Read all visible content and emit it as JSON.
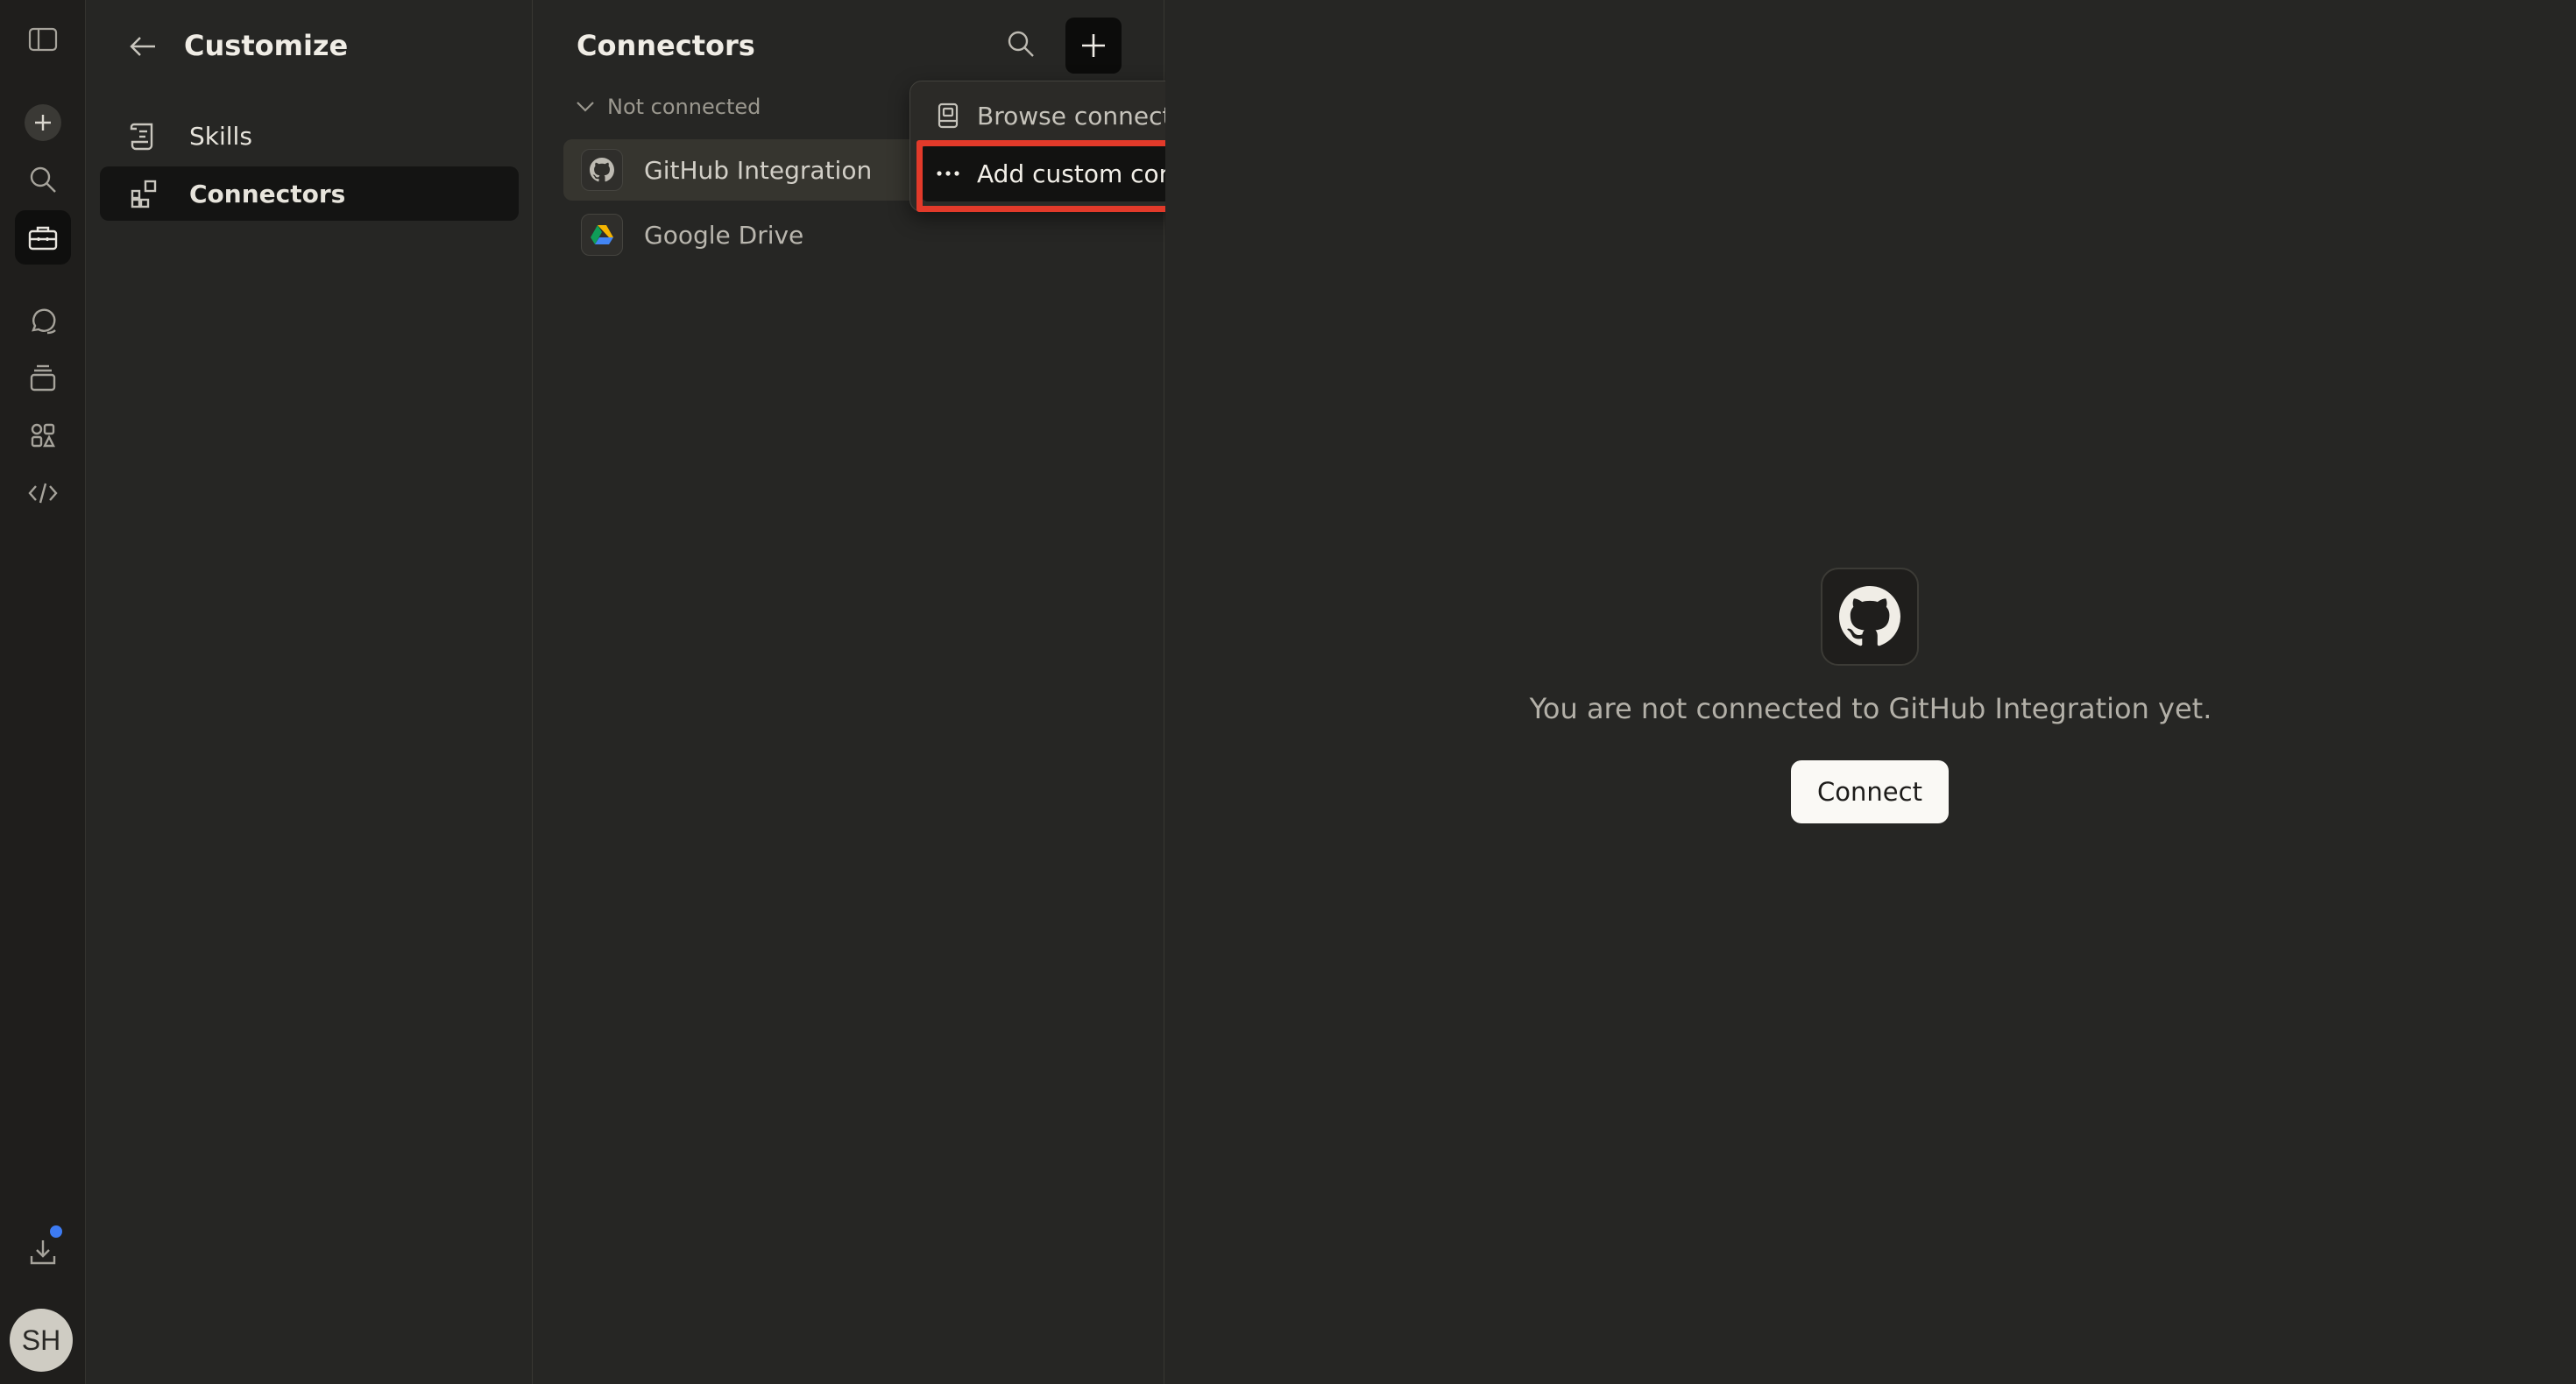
{
  "rail": {
    "items": [
      {
        "name": "toggle-sidebar-icon"
      },
      {
        "name": "new-chat-icon"
      },
      {
        "name": "search-icon"
      },
      {
        "name": "customize-icon",
        "active": true
      },
      {
        "name": "chats-icon"
      },
      {
        "name": "projects-icon"
      },
      {
        "name": "artifacts-icon"
      },
      {
        "name": "code-icon"
      },
      {
        "name": "download-icon"
      }
    ],
    "avatar_initials": "SH",
    "badge_color": "#3d7bf2"
  },
  "customize": {
    "title": "Customize",
    "nav": [
      {
        "label": "Skills",
        "icon": "skills-icon",
        "active": false
      },
      {
        "label": "Connectors",
        "icon": "connectors-icon",
        "active": true
      }
    ]
  },
  "connectors": {
    "title": "Connectors",
    "group_label": "Not connected",
    "items": [
      {
        "label": "GitHub Integration",
        "icon": "github-icon",
        "selected": true
      },
      {
        "label": "Google Drive",
        "icon": "google-drive-icon",
        "selected": false
      }
    ]
  },
  "menu": {
    "items": [
      {
        "label": "Browse connectors",
        "icon": "book-icon"
      },
      {
        "label": "Add custom connector",
        "icon": "more-icon",
        "highlighted": true
      }
    ]
  },
  "annotation": {
    "color": "#e23a2a"
  },
  "detail": {
    "message": "You are not connected to GitHub Integration yet.",
    "connect_label": "Connect"
  }
}
